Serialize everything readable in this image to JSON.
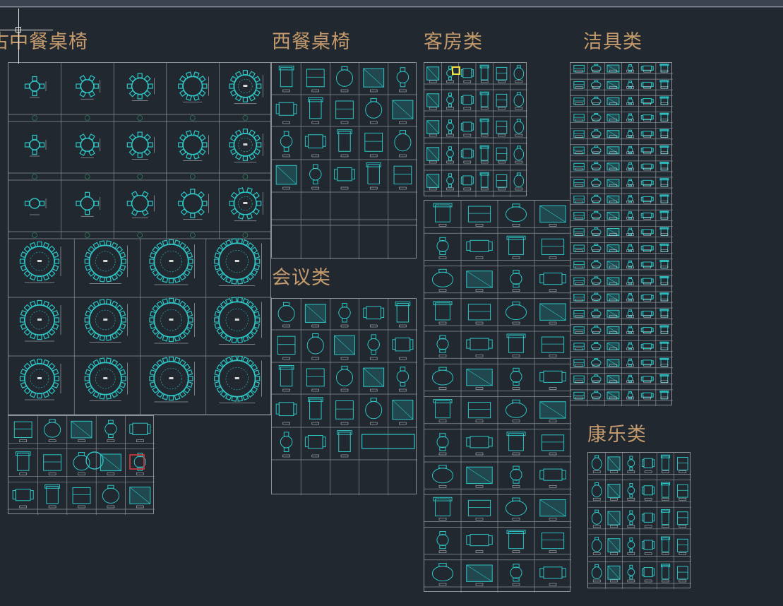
{
  "sections": {
    "chinese_dining": {
      "title": "中餐桌椅",
      "cut_prefix": "古"
    },
    "western_dining": {
      "title": "西餐桌椅"
    },
    "guest_room": {
      "title": "客房类"
    },
    "sanitary": {
      "title": "洁具类"
    },
    "conference": {
      "title": "会议类"
    },
    "recreation": {
      "title": "康乐类"
    }
  },
  "colors": {
    "background": "#212830",
    "title": "#c49a6c",
    "sheet_border": "#8b9096",
    "symbol": "#2ec4c4",
    "hatch": "#1fa6a6",
    "highlight": "#f0e040",
    "alert": "#d83a3a"
  },
  "icons": {
    "cursor": "crosshair-cursor-icon",
    "round_table": "round-table-icon",
    "furniture": "furniture-block-icon"
  }
}
